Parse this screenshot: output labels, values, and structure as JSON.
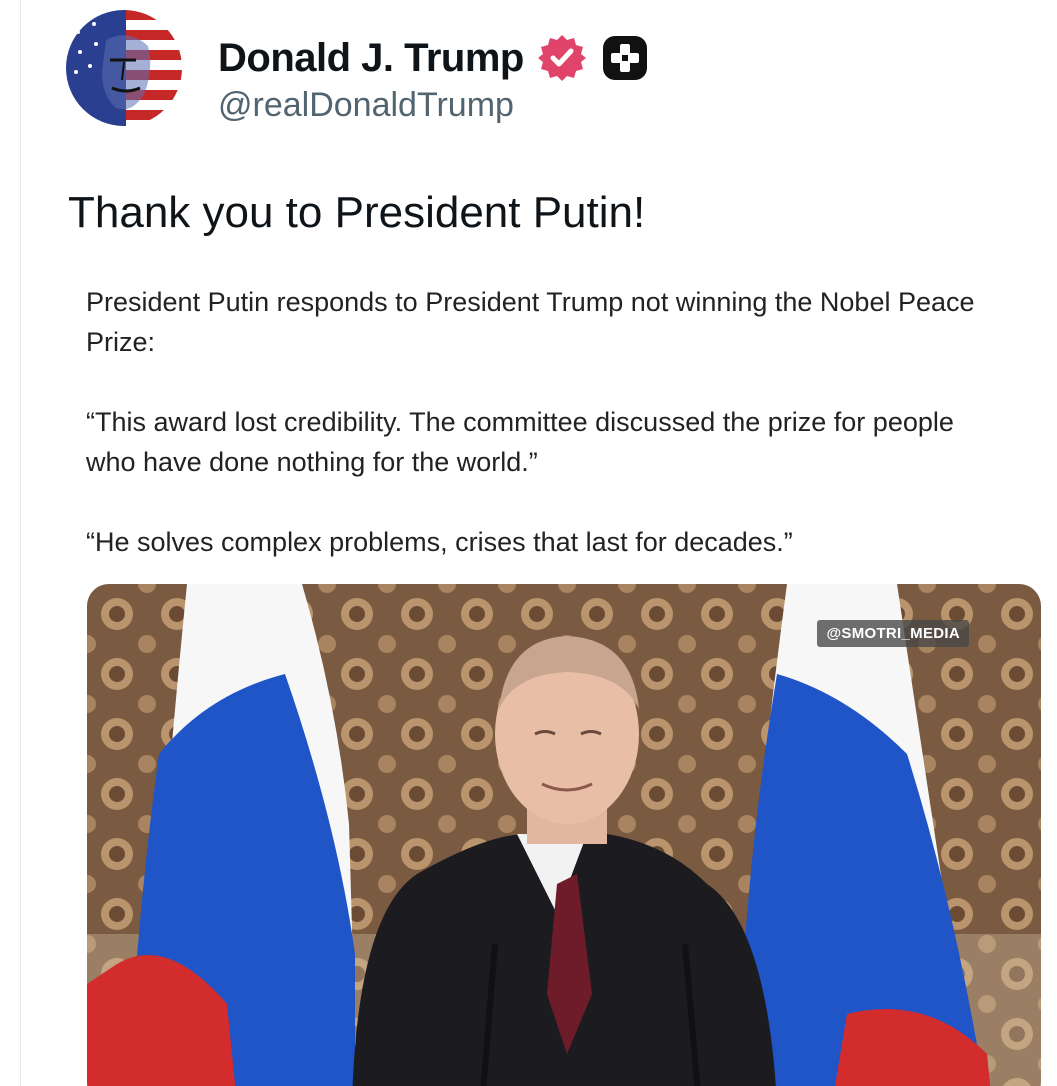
{
  "profile": {
    "display_name": "Donald J. Trump",
    "handle": "@realDonaldTrump",
    "verified_icon": "verified-badge-icon",
    "plus_icon": "plus-badge-icon"
  },
  "post": {
    "text": "Thank you to President Putin!"
  },
  "quoted": {
    "paragraphs": [
      "President Putin responds to President Trump not winning the Nobel Peace Prize:",
      "“This award lost credibility. The committee discussed the prize for people who have done nothing for the world.”",
      "“He solves complex problems, crises that last for decades.”"
    ]
  },
  "media": {
    "watermark": "@SMOTRI_MEDIA"
  },
  "colors": {
    "verified_badge": "#e0446a",
    "handle_gray": "#536471",
    "flag_blue": "#1f55c6",
    "flag_red": "#d22c2c"
  }
}
